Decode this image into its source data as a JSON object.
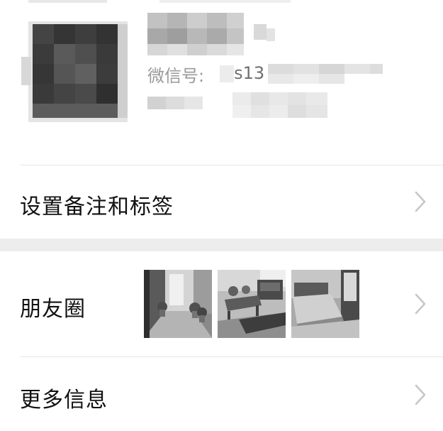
{
  "profile": {
    "wechat_id_label": "微信号:",
    "wechat_id_visible_fragment": "s13"
  },
  "cells": {
    "remark_label": "设置备注和标签",
    "moments_label": "朋友圈",
    "more_info_label": "更多信息"
  },
  "icons": {
    "chevron": "chevron-right-icon"
  },
  "colors": {
    "background": "#ffffff",
    "section_gap": "#ededed",
    "divider": "#e6e6e6",
    "secondary_text": "#9a9a9a",
    "chevron": "#c7c7c7"
  }
}
